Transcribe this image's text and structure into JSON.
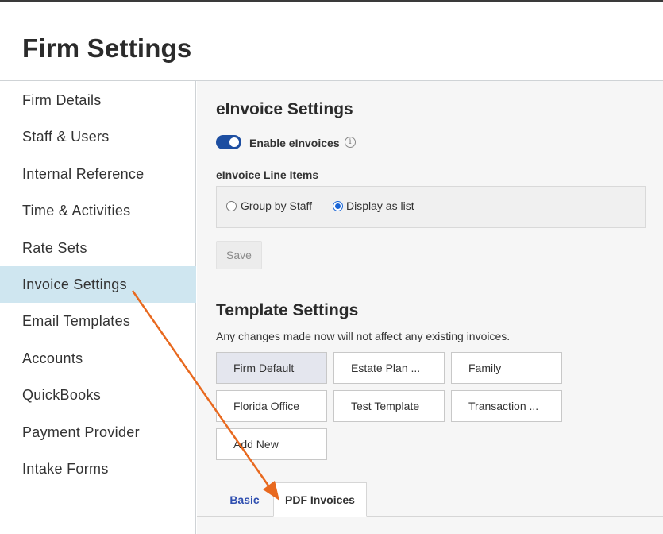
{
  "page": {
    "title": "Firm Settings"
  },
  "sidebar": {
    "items": [
      {
        "label": "Firm Details"
      },
      {
        "label": "Staff & Users"
      },
      {
        "label": "Internal Reference"
      },
      {
        "label": "Time & Activities"
      },
      {
        "label": "Rate Sets"
      },
      {
        "label": "Invoice Settings",
        "active": true
      },
      {
        "label": "Email Templates"
      },
      {
        "label": "Accounts"
      },
      {
        "label": "QuickBooks"
      },
      {
        "label": "Payment Provider"
      },
      {
        "label": "Intake Forms"
      }
    ]
  },
  "einvoice": {
    "title": "eInvoice Settings",
    "enable_label": "Enable eInvoices",
    "enabled": true,
    "info_icon": "i",
    "line_items_label": "eInvoice Line Items",
    "options": [
      {
        "label": "Group by Staff",
        "checked": false
      },
      {
        "label": "Display as list",
        "checked": true
      }
    ],
    "save_label": "Save"
  },
  "templates": {
    "title": "Template Settings",
    "note": "Any changes made now will not affect any existing invoices.",
    "buttons": [
      {
        "label": "Firm Default",
        "selected": true
      },
      {
        "label": "Estate Plan ..."
      },
      {
        "label": "Family"
      },
      {
        "label": "Florida Office"
      },
      {
        "label": "Test Template"
      },
      {
        "label": "Transaction ..."
      },
      {
        "label": "Add New"
      }
    ]
  },
  "tabs": [
    {
      "label": "Basic"
    },
    {
      "label": "PDF Invoices",
      "active": true
    }
  ],
  "colors": {
    "accent": "#1d4ea1",
    "active_sidebar_bg": "#cfe6f0",
    "annotation_arrow": "#e8691f"
  }
}
